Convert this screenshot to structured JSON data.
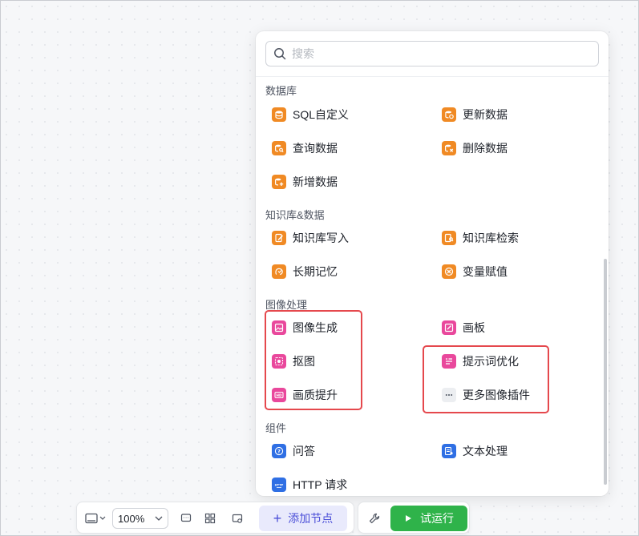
{
  "search": {
    "placeholder": "搜索"
  },
  "sections": {
    "database": {
      "title": "数据库",
      "items": [
        "SQL自定义",
        "更新数据",
        "查询数据",
        "删除数据",
        "新增数据"
      ]
    },
    "knowledge": {
      "title": "知识库&数据",
      "items": [
        "知识库写入",
        "知识库检索",
        "长期记忆",
        "变量赋值"
      ]
    },
    "image": {
      "title": "图像处理",
      "items": [
        "图像生成",
        "画板",
        "抠图",
        "提示词优化",
        "画质提升",
        "更多图像插件"
      ]
    },
    "components": {
      "title": "组件",
      "items": [
        "问答",
        "文本处理",
        "HTTP 请求"
      ]
    }
  },
  "toolbar": {
    "zoom": "100%",
    "add_node": "添加节点",
    "run": "试运行"
  },
  "colors": {
    "database_icon": "#f08a24",
    "image_icon": "#e9489c",
    "component_icon": "#2f6fe4",
    "highlight": "#e5484d",
    "run_button": "#2fb34a",
    "add_node_bg": "#e9eafc"
  }
}
